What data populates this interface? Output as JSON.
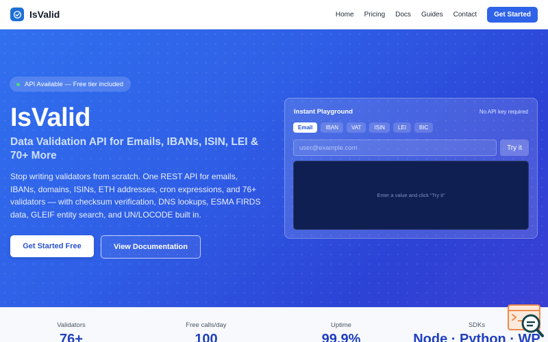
{
  "nav": {
    "brand": "IsValid",
    "links": [
      "Home",
      "Pricing",
      "Docs",
      "Guides",
      "Contact"
    ],
    "cta": "Get Started"
  },
  "hero": {
    "badge": "API Available — Free tier included",
    "title": "IsValid",
    "subtitle": "Data Validation API for Emails, IBANs, ISIN, LEI & 70+ More",
    "description": "Stop writing validators from scratch. One REST API for emails, IBANs, domains, ISINs, ETH addresses, cron expressions, and 76+ validators — with checksum verification, DNS lookups, ESMA FIRDS data, GLEIF entity search, and UN/LOCODE built in.",
    "primary_button": "Get Started Free",
    "secondary_button": "View Documentation"
  },
  "playground": {
    "title": "Instant Playground",
    "note": "No API key required",
    "tabs": [
      "Email",
      "IBAN",
      "VAT",
      "ISIN",
      "LEI",
      "BIC"
    ],
    "active_tab": "Email",
    "input_placeholder": "user@example.com",
    "try_button": "Try it",
    "output_hint": "Enter a value and click \"Try it\""
  },
  "stats": [
    {
      "label": "Validators",
      "value": "76+"
    },
    {
      "label": "Free calls/day",
      "value": "100"
    },
    {
      "label": "Uptime",
      "value": "99.9%"
    },
    {
      "label": "SDKs",
      "value": "Node · Python · WP"
    }
  ],
  "colors": {
    "accent": "#2f63e8",
    "badge_dot": "#4ade80",
    "output_bg": "#0f1f52",
    "stat_value": "#1f3fbf"
  },
  "icons": {
    "brand": "check-circle-icon",
    "corner": "search-terminal-icon"
  }
}
